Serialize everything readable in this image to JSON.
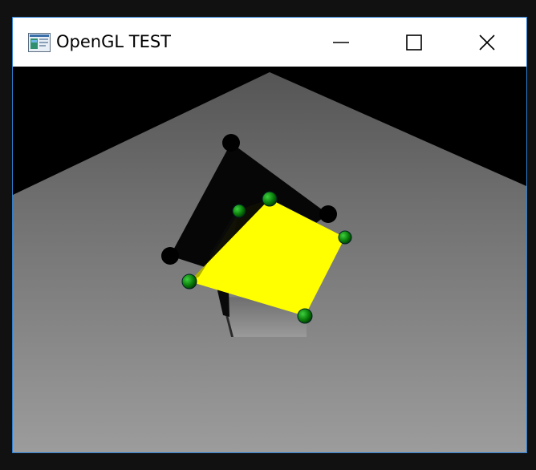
{
  "window": {
    "title": "OpenGL TEST",
    "icon": "app-window-icon",
    "controls": {
      "minimize_icon": "minimize-icon",
      "maximize_icon": "maximize-icon",
      "close_icon": "close-icon"
    }
  },
  "scene": {
    "background_color": "#000000",
    "floor_color_far": "#5a5a5a",
    "floor_color_near": "#9a9a9a",
    "quad_color": "#ffff00",
    "shadow_color": "#000000",
    "control_point_color": "#0b8a0b"
  },
  "border_color": "#2f7fd0"
}
